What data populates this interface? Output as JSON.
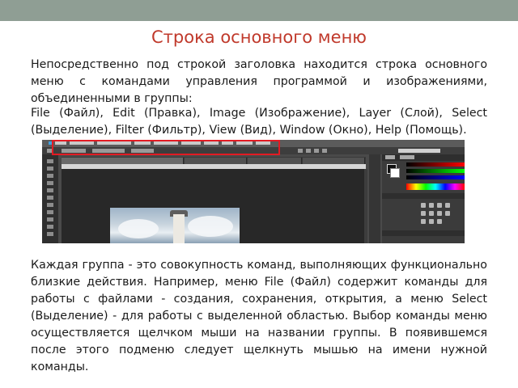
{
  "slide": {
    "title": "Строка основного меню",
    "paragraph1": "Непосредственно под строкой заголовка находится строка основного меню с командами управления программой и изображениями, объединенными в группы:",
    "paragraph2": "File (Файл), Edit (Правка), Image (Изображение), Layer (Слой), Select (Выделение), Filter (Фильтр), View (Вид), Window (Окно), Help (Помощь).",
    "paragraph3": "Каждая группа - это совокупность команд, выполняющих функционально близкие действия. Например, меню File (Файл) содержит команды для работы с файлами - создания, сохранения, открытия, а меню Select (Выделение) - для работы с выделенной областью. Выбор команды меню осуществляется щелчком мыши на названии группы. В появившемся после этого подменю следует щелкнуть мышью на имени нужной команды."
  },
  "colors": {
    "title": "#c0392b",
    "topbar": "#8f9e94",
    "highlight": "#e31b23"
  }
}
